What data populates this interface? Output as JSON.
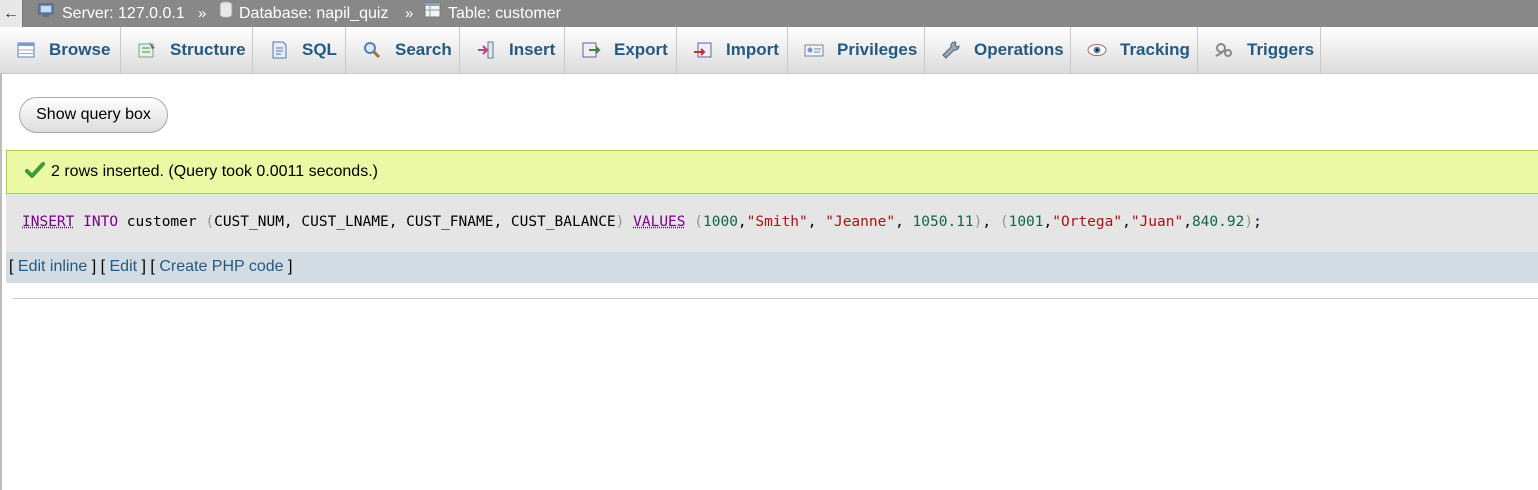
{
  "breadcrumb": {
    "back": "←",
    "server": "Server: 127.0.0.1",
    "database": "Database: napil_quiz",
    "table": "Table: customer",
    "separator": "»"
  },
  "tabs": [
    {
      "label": "Browse",
      "icon": "browse-icon"
    },
    {
      "label": "Structure",
      "icon": "structure-icon"
    },
    {
      "label": "SQL",
      "icon": "sql-icon"
    },
    {
      "label": "Search",
      "icon": "search-icon"
    },
    {
      "label": "Insert",
      "icon": "insert-icon"
    },
    {
      "label": "Export",
      "icon": "export-icon"
    },
    {
      "label": "Import",
      "icon": "import-icon"
    },
    {
      "label": "Privileges",
      "icon": "privileges-icon"
    },
    {
      "label": "Operations",
      "icon": "operations-icon"
    },
    {
      "label": "Tracking",
      "icon": "tracking-icon"
    },
    {
      "label": "Triggers",
      "icon": "triggers-icon"
    }
  ],
  "query_box_button": "Show query box",
  "success_message": "2 rows inserted. (Query took 0.0011 seconds.)",
  "sql": {
    "insert": "INSERT",
    "into": "INTO",
    "table": "customer",
    "open": "(",
    "columns": "CUST_NUM, CUST_LNAME, CUST_FNAME, CUST_BALANCE",
    "close": ")",
    "values": "VALUES",
    "row1": {
      "num": "1000",
      "lname": "\"Smith\"",
      "fname": "\"Jeanne\"",
      "bal": "1050.11"
    },
    "row2": {
      "num": "1001",
      "lname": "\"Ortega\"",
      "fname": "\"Juan\"",
      "bal": "840.92"
    }
  },
  "actions": {
    "edit_inline": "Edit inline",
    "edit": "Edit",
    "create_php": "Create PHP code"
  },
  "colors": {
    "link": "#235a81",
    "success_bg": "#ebf8a4",
    "keyword": "#770088",
    "string": "#aa1111",
    "number": "#116644"
  }
}
